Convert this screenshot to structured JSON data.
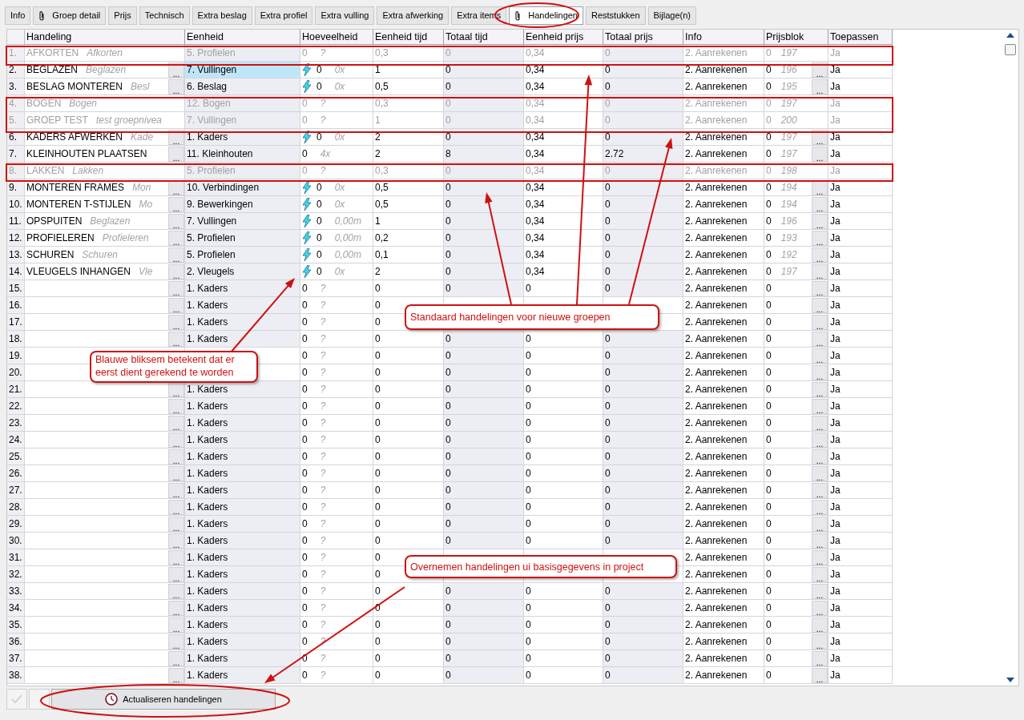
{
  "tabs": [
    {
      "label": "Info",
      "attachment": false,
      "selected": false
    },
    {
      "label": "Groep detail",
      "attachment": true,
      "selected": false
    },
    {
      "label": "Prijs",
      "attachment": false,
      "selected": false
    },
    {
      "label": "Technisch",
      "attachment": false,
      "selected": false
    },
    {
      "label": "Extra beslag",
      "attachment": false,
      "selected": false
    },
    {
      "label": "Extra profiel",
      "attachment": false,
      "selected": false
    },
    {
      "label": "Extra vulling",
      "attachment": false,
      "selected": false
    },
    {
      "label": "Extra afwerking",
      "attachment": false,
      "selected": false
    },
    {
      "label": "Extra items",
      "attachment": false,
      "selected": false
    },
    {
      "label": "Handelingen",
      "attachment": true,
      "selected": true
    },
    {
      "label": "Reststukken",
      "attachment": false,
      "selected": false
    },
    {
      "label": "Bijlage(n)",
      "attachment": false,
      "selected": false
    }
  ],
  "table": {
    "columns": [
      "Handeling",
      "Eenheid",
      "Hoeveelheid",
      "Eenheid tijd",
      "Totaal tijd",
      "Eenheid prijs",
      "Totaal prijs",
      "Info",
      "Prijsblok",
      "Toepassen"
    ],
    "rows": [
      {
        "num": "1.",
        "name": "AFKORTEN",
        "hint": "Afkorten",
        "unit": "5. Profielen",
        "selected": false,
        "bolt": false,
        "qty": "0",
        "qty_hint": "?",
        "unit_time": "0,3",
        "total_time": "0",
        "unit_price": "0,34",
        "total_price": "0",
        "info": "2. Aanrekenen",
        "block": "0",
        "block_hint": "197",
        "apply": "Ja",
        "disabled": true
      },
      {
        "num": "2.",
        "name": "BEGLAZEN",
        "hint": "Beglazen",
        "edit_button": "...",
        "unit": "7. Vullingen",
        "selected": true,
        "bolt": true,
        "qty": "0",
        "qty_hint": "0x",
        "unit_time": "1",
        "total_time": "0",
        "unit_price": "0,34",
        "total_price": "0",
        "info": "2. Aanrekenen",
        "block": "0",
        "block_hint": "196",
        "block_button": "...",
        "apply": "Ja",
        "disabled": false
      },
      {
        "num": "3.",
        "name": "BESLAG MONTEREN",
        "hint": "Besl",
        "edit_button": "...",
        "unit": "6. Beslag",
        "selected": false,
        "bolt": true,
        "qty": "0",
        "qty_hint": "0x",
        "unit_time": "0,5",
        "total_time": "0",
        "unit_price": "0,34",
        "total_price": "0",
        "info": "2. Aanrekenen",
        "block": "0",
        "block_hint": "195",
        "block_button": "...",
        "apply": "Ja",
        "disabled": false
      },
      {
        "num": "4.",
        "name": "BOGEN",
        "hint": "Bogen",
        "unit": "12. Bogen",
        "selected": false,
        "bolt": false,
        "qty": "0",
        "qty_hint": "?",
        "unit_time": "0,3",
        "total_time": "0",
        "unit_price": "0,34",
        "total_price": "0",
        "info": "2. Aanrekenen",
        "block": "0",
        "block_hint": "197",
        "apply": "Ja",
        "disabled": true
      },
      {
        "num": "5.",
        "name": "GROEP TEST",
        "hint": "test groepnivea",
        "unit": "7. Vullingen",
        "selected": false,
        "bolt": false,
        "qty": "0",
        "qty_hint": "?",
        "unit_time": "1",
        "total_time": "0",
        "unit_price": "0,34",
        "total_price": "0",
        "info": "2. Aanrekenen",
        "block": "0",
        "block_hint": "200",
        "apply": "Ja",
        "disabled": true
      },
      {
        "num": "6.",
        "name": "KADERS AFWERKEN",
        "hint": "Kade",
        "edit_button": "...",
        "unit": "1. Kaders",
        "selected": false,
        "bolt": true,
        "qty": "0",
        "qty_hint": "0x",
        "unit_time": "2",
        "total_time": "0",
        "unit_price": "0,34",
        "total_price": "0",
        "info": "2. Aanrekenen",
        "block": "0",
        "block_hint": "197",
        "block_button": "...",
        "apply": "Ja",
        "disabled": false
      },
      {
        "num": "7.",
        "name": "KLEINHOUTEN PLAATSEN",
        "edit_button": "...",
        "unit": "11. Kleinhouten",
        "selected": false,
        "bolt": false,
        "qty": "0",
        "qty_hint": "4x",
        "unit_time": "2",
        "total_time": "8",
        "unit_price": "0,34",
        "total_price": "2.72",
        "info": "2. Aanrekenen",
        "block": "0",
        "block_hint": "197",
        "block_button": "...",
        "apply": "Ja",
        "disabled": false
      },
      {
        "num": "8.",
        "name": "LAKKEN",
        "hint": "Lakken",
        "unit": "5. Profielen",
        "selected": false,
        "bolt": false,
        "qty": "0",
        "qty_hint": "?",
        "unit_time": "0,3",
        "total_time": "0",
        "unit_price": "0,34",
        "total_price": "0",
        "info": "2. Aanrekenen",
        "block": "0",
        "block_hint": "198",
        "apply": "Ja",
        "disabled": true
      },
      {
        "num": "9.",
        "name": "MONTEREN FRAMES",
        "hint": "Mon",
        "edit_button": "...",
        "unit": "10. Verbindingen",
        "selected": false,
        "bolt": true,
        "qty": "0",
        "qty_hint": "0x",
        "unit_time": "0,5",
        "total_time": "0",
        "unit_price": "0,34",
        "total_price": "0",
        "info": "2. Aanrekenen",
        "block": "0",
        "block_hint": "194",
        "block_button": "...",
        "apply": "Ja",
        "disabled": false
      },
      {
        "num": "10.",
        "name": "MONTEREN T-STIJLEN",
        "hint": "Mo",
        "edit_button": "...",
        "unit": "9. Bewerkingen",
        "selected": false,
        "bolt": true,
        "qty": "0",
        "qty_hint": "0x",
        "unit_time": "0,5",
        "total_time": "0",
        "unit_price": "0,34",
        "total_price": "0",
        "info": "2. Aanrekenen",
        "block": "0",
        "block_hint": "194",
        "block_button": "...",
        "apply": "Ja",
        "disabled": false
      },
      {
        "num": "11.",
        "name": "OPSPUITEN",
        "hint": "Beglazen",
        "edit_button": "...",
        "unit": "7. Vullingen",
        "selected": false,
        "bolt": true,
        "qty": "0",
        "qty_hint": "0,00m",
        "unit_time": "1",
        "total_time": "0",
        "unit_price": "0,34",
        "total_price": "0",
        "info": "2. Aanrekenen",
        "block": "0",
        "block_hint": "196",
        "block_button": "...",
        "apply": "Ja",
        "disabled": false
      },
      {
        "num": "12.",
        "name": "PROFIELEREN",
        "hint": "Profieleren",
        "edit_button": "...",
        "unit": "5. Profielen",
        "selected": false,
        "bolt": true,
        "qty": "0",
        "qty_hint": "0,00m",
        "unit_time": "0,2",
        "total_time": "0",
        "unit_price": "0,34",
        "total_price": "0",
        "info": "2. Aanrekenen",
        "block": "0",
        "block_hint": "193",
        "block_button": "...",
        "apply": "Ja",
        "disabled": false
      },
      {
        "num": "13.",
        "name": "SCHUREN",
        "hint": "Schuren",
        "edit_button": "...",
        "unit": "5. Profielen",
        "selected": false,
        "bolt": true,
        "qty": "0",
        "qty_hint": "0,00m",
        "unit_time": "0,1",
        "total_time": "0",
        "unit_price": "0,34",
        "total_price": "0",
        "info": "2. Aanrekenen",
        "block": "0",
        "block_hint": "192",
        "block_button": "...",
        "apply": "Ja",
        "disabled": false
      },
      {
        "num": "14.",
        "name": "VLEUGELS INHANGEN",
        "hint": "Vle",
        "edit_button": "...",
        "unit": "2. Vleugels",
        "selected": false,
        "bolt": true,
        "qty": "0",
        "qty_hint": "0x",
        "unit_time": "2",
        "total_time": "0",
        "unit_price": "0,34",
        "total_price": "0",
        "info": "2. Aanrekenen",
        "block": "0",
        "block_hint": "197",
        "block_button": "...",
        "apply": "Ja",
        "disabled": false
      },
      {
        "num": "15.",
        "edit_button": "...",
        "unit": "1. Kaders",
        "selected": false,
        "bolt": false,
        "qty": "0",
        "qty_hint": "?",
        "unit_time": "0",
        "total_time": "0",
        "unit_price": "0",
        "total_price": "0",
        "info": "2. Aanrekenen",
        "block": "0",
        "block_button": "...",
        "apply": "Ja",
        "disabled": false
      },
      {
        "num": "16.",
        "edit_button": "...",
        "unit": "1. Kaders",
        "selected": false,
        "bolt": false,
        "qty": "0",
        "qty_hint": "?",
        "unit_time": "0",
        "info": "2. Aanrekenen",
        "block": "0",
        "block_button": "...",
        "apply": "Ja",
        "disabled": false
      },
      {
        "num": "17.",
        "edit_button": "...",
        "unit": "1. Kaders",
        "selected": false,
        "bolt": false,
        "qty": "0",
        "qty_hint": "?",
        "unit_time": "0",
        "info": "2. Aanrekenen",
        "block": "0",
        "block_button": "...",
        "apply": "Ja",
        "disabled": false
      },
      {
        "num": "18.",
        "edit_button": "...",
        "unit": "1. Kaders",
        "selected": false,
        "bolt": false,
        "qty": "0",
        "qty_hint": "?",
        "unit_time": "0",
        "total_time": "0",
        "unit_price": "0",
        "total_price": "0",
        "info": "2. Aanrekenen",
        "block": "0",
        "block_button": "...",
        "apply": "Ja",
        "disabled": false
      },
      {
        "num": "19.",
        "selected": false,
        "bolt": false,
        "qty": "0",
        "qty_hint": "?",
        "unit_time": "0",
        "total_time": "0",
        "unit_price": "0",
        "total_price": "0",
        "info": "2. Aanrekenen",
        "block": "0",
        "block_button": "...",
        "apply": "Ja",
        "disabled": false
      },
      {
        "num": "20.",
        "selected": false,
        "bolt": false,
        "qty": "0",
        "qty_hint": "?",
        "unit_time": "0",
        "total_time": "0",
        "unit_price": "0",
        "total_price": "0",
        "info": "2. Aanrekenen",
        "block": "0",
        "block_button": "...",
        "apply": "Ja",
        "disabled": false
      },
      {
        "num": "21.",
        "edit_button": "...",
        "unit": "1. Kaders",
        "selected": false,
        "bolt": false,
        "qty": "0",
        "qty_hint": "?",
        "unit_time": "0",
        "total_time": "0",
        "unit_price": "0",
        "total_price": "0",
        "info": "2. Aanrekenen",
        "block": "0",
        "block_button": "...",
        "apply": "Ja",
        "disabled": false
      },
      {
        "num": "22.",
        "edit_button": "...",
        "unit": "1. Kaders",
        "selected": false,
        "bolt": false,
        "qty": "0",
        "qty_hint": "?",
        "unit_time": "0",
        "total_time": "0",
        "unit_price": "0",
        "total_price": "0",
        "info": "2. Aanrekenen",
        "block": "0",
        "block_button": "...",
        "apply": "Ja",
        "disabled": false
      },
      {
        "num": "23.",
        "edit_button": "...",
        "unit": "1. Kaders",
        "selected": false,
        "bolt": false,
        "qty": "0",
        "qty_hint": "?",
        "unit_time": "0",
        "total_time": "0",
        "unit_price": "0",
        "total_price": "0",
        "info": "2. Aanrekenen",
        "block": "0",
        "block_button": "...",
        "apply": "Ja",
        "disabled": false
      },
      {
        "num": "24.",
        "edit_button": "...",
        "unit": "1. Kaders",
        "selected": false,
        "bolt": false,
        "qty": "0",
        "qty_hint": "?",
        "unit_time": "0",
        "total_time": "0",
        "unit_price": "0",
        "total_price": "0",
        "info": "2. Aanrekenen",
        "block": "0",
        "block_button": "...",
        "apply": "Ja",
        "disabled": false
      },
      {
        "num": "25.",
        "edit_button": "...",
        "unit": "1. Kaders",
        "selected": false,
        "bolt": false,
        "qty": "0",
        "qty_hint": "?",
        "unit_time": "0",
        "total_time": "0",
        "unit_price": "0",
        "total_price": "0",
        "info": "2. Aanrekenen",
        "block": "0",
        "block_button": "...",
        "apply": "Ja",
        "disabled": false
      },
      {
        "num": "26.",
        "edit_button": "...",
        "unit": "1. Kaders",
        "selected": false,
        "bolt": false,
        "qty": "0",
        "qty_hint": "?",
        "unit_time": "0",
        "total_time": "0",
        "unit_price": "0",
        "total_price": "0",
        "info": "2. Aanrekenen",
        "block": "0",
        "block_button": "...",
        "apply": "Ja",
        "disabled": false
      },
      {
        "num": "27.",
        "edit_button": "...",
        "unit": "1. Kaders",
        "selected": false,
        "bolt": false,
        "qty": "0",
        "qty_hint": "?",
        "unit_time": "0",
        "total_time": "0",
        "unit_price": "0",
        "total_price": "0",
        "info": "2. Aanrekenen",
        "block": "0",
        "block_button": "...",
        "apply": "Ja",
        "disabled": false
      },
      {
        "num": "28.",
        "edit_button": "...",
        "unit": "1. Kaders",
        "selected": false,
        "bolt": false,
        "qty": "0",
        "qty_hint": "?",
        "unit_time": "0",
        "total_time": "0",
        "unit_price": "0",
        "total_price": "0",
        "info": "2. Aanrekenen",
        "block": "0",
        "block_button": "...",
        "apply": "Ja",
        "disabled": false
      },
      {
        "num": "29.",
        "edit_button": "...",
        "unit": "1. Kaders",
        "selected": false,
        "bolt": false,
        "qty": "0",
        "qty_hint": "?",
        "unit_time": "0",
        "total_time": "0",
        "unit_price": "0",
        "total_price": "0",
        "info": "2. Aanrekenen",
        "block": "0",
        "block_button": "...",
        "apply": "Ja",
        "disabled": false
      },
      {
        "num": "30.",
        "edit_button": "...",
        "unit": "1. Kaders",
        "selected": false,
        "bolt": false,
        "qty": "0",
        "qty_hint": "?",
        "unit_time": "0",
        "total_time": "0",
        "unit_price": "0",
        "total_price": "0",
        "info": "2. Aanrekenen",
        "block": "0",
        "block_button": "...",
        "apply": "Ja",
        "disabled": false
      },
      {
        "num": "31.",
        "edit_button": "...",
        "unit": "1. Kaders",
        "selected": false,
        "bolt": false,
        "qty": "0",
        "qty_hint": "?",
        "unit_time": "0",
        "info": "2. Aanrekenen",
        "block": "0",
        "block_button": "...",
        "apply": "Ja",
        "disabled": false
      },
      {
        "num": "32.",
        "edit_button": "...",
        "unit": "1. Kaders",
        "selected": false,
        "bolt": false,
        "qty": "0",
        "qty_hint": "?",
        "unit_time": "0",
        "info": "2. Aanrekenen",
        "block": "0",
        "block_button": "...",
        "apply": "Ja",
        "disabled": false
      },
      {
        "num": "33.",
        "edit_button": "...",
        "unit": "1. Kaders",
        "selected": false,
        "bolt": false,
        "qty": "0",
        "qty_hint": "?",
        "unit_time": "0",
        "total_time": "0",
        "unit_price": "0",
        "total_price": "0",
        "info": "2. Aanrekenen",
        "block": "0",
        "block_button": "...",
        "apply": "Ja",
        "disabled": false
      },
      {
        "num": "34.",
        "edit_button": "...",
        "unit": "1. Kaders",
        "selected": false,
        "bolt": false,
        "qty": "0",
        "qty_hint": "?",
        "unit_time": "0",
        "total_time": "0",
        "unit_price": "0",
        "total_price": "0",
        "info": "2. Aanrekenen",
        "block": "0",
        "block_button": "...",
        "apply": "Ja",
        "disabled": false
      },
      {
        "num": "35.",
        "edit_button": "...",
        "unit": "1. Kaders",
        "selected": false,
        "bolt": false,
        "qty": "0",
        "qty_hint": "?",
        "unit_time": "0",
        "total_time": "0",
        "unit_price": "0",
        "total_price": "0",
        "info": "2. Aanrekenen",
        "block": "0",
        "block_button": "...",
        "apply": "Ja",
        "disabled": false
      },
      {
        "num": "36.",
        "edit_button": "...",
        "unit": "1. Kaders",
        "selected": false,
        "bolt": false,
        "qty": "0",
        "qty_hint": "?",
        "unit_time": "0",
        "total_time": "0",
        "unit_price": "0",
        "total_price": "0",
        "info": "2. Aanrekenen",
        "block": "0",
        "block_button": "...",
        "apply": "Ja",
        "disabled": false
      },
      {
        "num": "37.",
        "edit_button": "...",
        "unit": "1. Kaders",
        "selected": false,
        "bolt": false,
        "qty": "0",
        "qty_hint": "?",
        "unit_time": "0",
        "total_time": "0",
        "unit_price": "0",
        "total_price": "0",
        "info": "2. Aanrekenen",
        "block": "0",
        "block_button": "...",
        "apply": "Ja",
        "disabled": false
      },
      {
        "num": "38.",
        "edit_button": "...",
        "unit": "1. Kaders",
        "selected": false,
        "bolt": false,
        "qty": "0",
        "qty_hint": "?",
        "unit_time": "0",
        "total_time": "0",
        "unit_price": "0",
        "total_price": "0",
        "info": "2. Aanrekenen",
        "block": "0",
        "block_button": "...",
        "apply": "Ja",
        "disabled": false
      }
    ]
  },
  "footer": {
    "action_button": "Actualiseren handelingen"
  },
  "callouts": [
    "Standaard handelingen voor nieuwe groepen",
    "Blauwe bliksem betekent dat er eerst dient gerekend te worden",
    "Overnemen handelingen ui basisgegevens in project"
  ]
}
